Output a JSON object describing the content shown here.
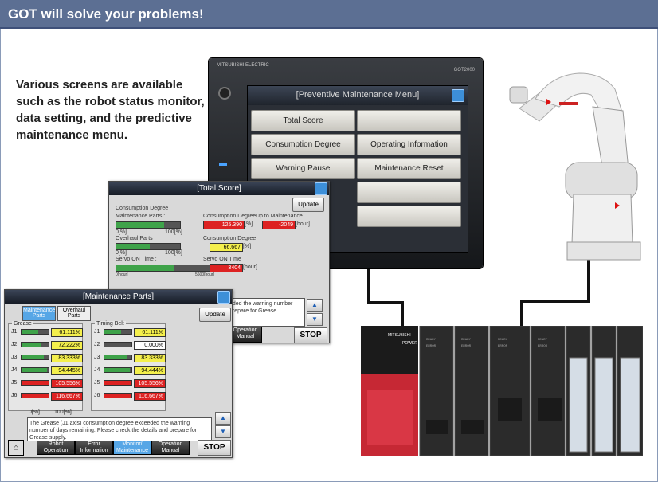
{
  "banner": {
    "title": "GOT will solve your problems!"
  },
  "intro": "Various screens are available such as the robot status monitor, data setting, and the predictive maintenance menu.",
  "got": {
    "brand": "MITSUBISHI ELECTRIC",
    "model": "GOT2000",
    "menu_title": "[Preventive Maintenance Menu]",
    "buttons": [
      "Total Score",
      "Consumption Degree",
      "Operating Information",
      "Warning Pause",
      "Maintenance Reset"
    ]
  },
  "total_score": {
    "title": "[Total Score]",
    "update": "Update",
    "consumption_degree": "Consumption Degree",
    "maintenance_parts": "Maintenance Parts :",
    "overhaul_parts": "Overhaul Parts :",
    "servo_on_time": "Servo ON Time :",
    "scale_min": "0[%]",
    "scale_max": "100[%]",
    "servo_min": "0[hour]",
    "servo_max": "5600[hour]",
    "cd_label": "Consumption Degree",
    "cd_value": "125.390",
    "cd_unit": "[%]",
    "upto_label": "Up to Maintenance",
    "upto_value": "-2049",
    "upto_unit": "[hour]",
    "cd2_label": "Consumption Degree",
    "cd2_value": "66.667",
    "cd2_unit": "[%]",
    "servo_label": "Servo ON Time",
    "servo_value": "3404",
    "servo_unit": "[hour]",
    "msg": "eded the warning number prepare for Grease",
    "operation": "Operation Manual",
    "stop": "STOP",
    "maint_fill": 0.75,
    "overhaul_fill": 0.52,
    "servo_fill": 0.6
  },
  "maintenance_parts": {
    "title": "[Maintenance Parts]",
    "tab1": "Maintenance Parts",
    "tab2": "Overhaul Parts",
    "update": "Update",
    "grease": "Grease",
    "timing_belt": "Timing Belt",
    "grease_rows": [
      {
        "j": "J1",
        "v": "61.111%",
        "c": "yel",
        "f": 0.61
      },
      {
        "j": "J2",
        "v": "72.222%",
        "c": "yel",
        "f": 0.72
      },
      {
        "j": "J3",
        "v": "83.333%",
        "c": "yel",
        "f": 0.83
      },
      {
        "j": "J4",
        "v": "94.445%",
        "c": "yel",
        "f": 0.94
      },
      {
        "j": "J5",
        "v": "105.556%",
        "c": "red",
        "f": 1.0
      },
      {
        "j": "J6",
        "v": "116.667%",
        "c": "red",
        "f": 1.0
      }
    ],
    "belt_rows": [
      {
        "j": "J1",
        "v": "61.111%",
        "c": "yel",
        "f": 0.61
      },
      {
        "j": "J2",
        "v": "0.000%",
        "c": "wht",
        "f": 0.0
      },
      {
        "j": "J3",
        "v": "83.333%",
        "c": "yel",
        "f": 0.83
      },
      {
        "j": "J4",
        "v": "94.444%",
        "c": "yel",
        "f": 0.94
      },
      {
        "j": "J5",
        "v": "105.556%",
        "c": "red",
        "f": 1.0
      },
      {
        "j": "J6",
        "v": "116.667%",
        "c": "red",
        "f": 1.0
      }
    ],
    "scale_min": "0[%]",
    "scale_max": "100[%]",
    "msg": "The Grease (J1 axis) consumption degree exceeded the warning number of days remaining. Please check the details and prepare for Grease supply.",
    "nav": [
      "Robot Operation",
      "Error Information",
      "Monitor/ Maintenance",
      "Operation Manual"
    ],
    "stop": "STOP"
  }
}
